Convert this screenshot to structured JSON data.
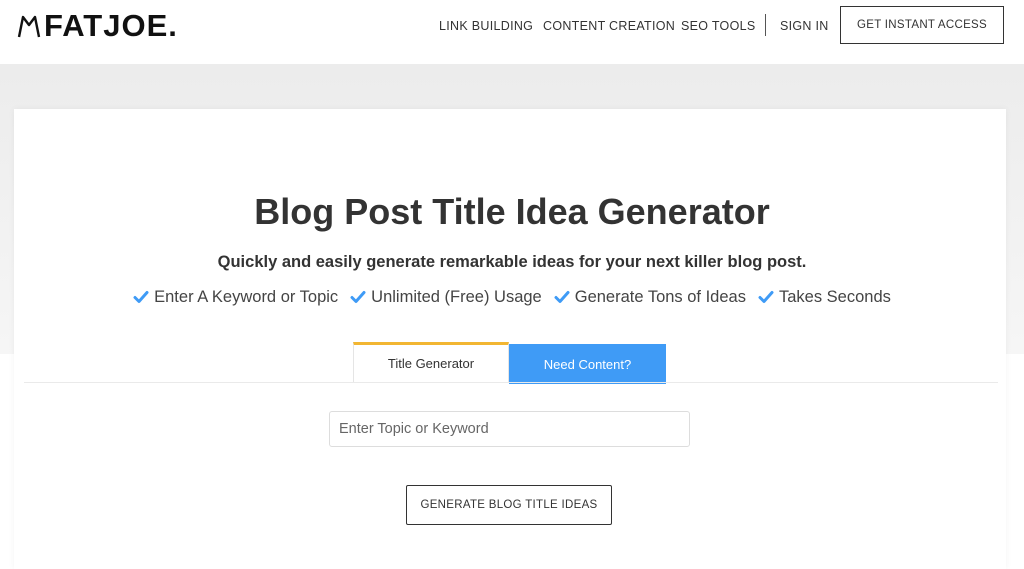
{
  "header": {
    "logo_text": "FATJOE.",
    "nav": [
      {
        "label": "LINK BUILDING"
      },
      {
        "label": "CONTENT CREATION"
      },
      {
        "label": "SEO TOOLS"
      },
      {
        "label": "SIGN IN"
      }
    ],
    "cta_label": "GET INSTANT ACCESS"
  },
  "hero": {
    "title": "Blog Post Title Idea Generator",
    "subtitle": "Quickly and easily generate remarkable ideas for your next killer blog post.",
    "features": [
      {
        "label": "Enter A Keyword or Topic",
        "icon": "check-icon"
      },
      {
        "label": "Unlimited (Free) Usage",
        "icon": "check-icon"
      },
      {
        "label": "Generate Tons of Ideas",
        "icon": "check-icon"
      },
      {
        "label": "Takes Seconds",
        "icon": "check-icon"
      }
    ]
  },
  "tabs": [
    {
      "label": "Title Generator",
      "active": true
    },
    {
      "label": "Need Content?",
      "active": false
    }
  ],
  "form": {
    "placeholder": "Enter Topic or Keyword",
    "value": "",
    "button_label": "GENERATE BLOG TITLE IDEAS"
  },
  "colors": {
    "accent_blue": "#3f9bf6",
    "tab_highlight": "#f2b632",
    "check": "#3f9bf6"
  }
}
